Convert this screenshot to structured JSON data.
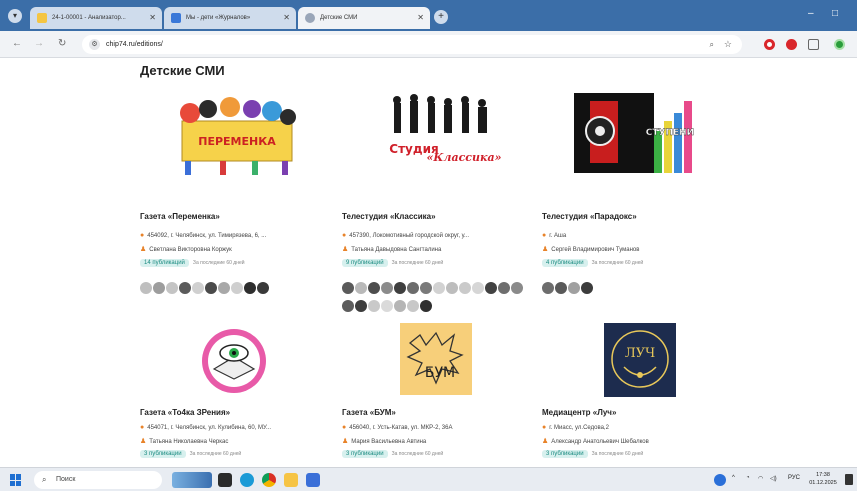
{
  "browser": {
    "tabs": [
      {
        "label": "24-1-00001 - Анализатор...",
        "favicon_color": "#f4c542",
        "active": false
      },
      {
        "label": "Мы - дети «Журналов»",
        "favicon_color": "#3a78d8",
        "active": false
      },
      {
        "label": "Детские СМИ",
        "favicon_color": "#9aa6b8",
        "active": true
      }
    ],
    "new_tab_symbol": "+",
    "url": "chip74.ru/editions/",
    "window_controls": {
      "minimize": "–",
      "maximize": "□"
    }
  },
  "page": {
    "title": "Детские СМИ"
  },
  "cards": [
    {
      "name": "Газета «Переменка»",
      "address": "454092, г. Челябинск, ул. Тимирязева, 6, ...",
      "person": "Светлана Викторовна Коржук",
      "publications": "14 публикаций",
      "note": "За последние 60 дней",
      "logo_text": "ПЕРЕМЕНКА",
      "avatars": [
        "#bfbfbf",
        "#9d9d9d",
        "#c4c4c4",
        "#5b5b5b",
        "#d0d0d0",
        "#4a4a4a",
        "#a8a8a8",
        "#cfcfcf",
        "#2e2e2e",
        "#3a3a3a"
      ]
    },
    {
      "name": "Телестудия «Классика»",
      "address": "457390, Локомотивный городской округ, у...",
      "person": "Татьяна Давыдовна Сангталина",
      "publications": "9 публикаций",
      "note": "За последние 60 дней",
      "logo_text": "Студия «Классика»",
      "avatars": [
        "#5a5a5a",
        "#b9b9b9",
        "#4d4d4d",
        "#8b8b8b",
        "#3f3f3f",
        "#6c6c6c",
        "#7a7a7a",
        "#d2d2d2",
        "#bdbdbd",
        "#cacaca",
        "#d6d6d6",
        "#424242",
        "#6e6e6e",
        "#8a8a8a",
        "#5c5c5c",
        "#3d3d3d",
        "#c9c9c9",
        "#dadada",
        "#b5b5b5",
        "#c8c8c8",
        "#2f2f2f"
      ]
    },
    {
      "name": "Телестудия «Парадокс»",
      "address": "г. Аша",
      "person": "Сергей Владимирович Туманов",
      "publications": "4 публикации",
      "note": "За последние 60 дней",
      "logo_text": "СТУПЕНИ",
      "avatars": [
        "#6d6d6d",
        "#595959",
        "#a0a0a0",
        "#3c3c3c"
      ]
    },
    {
      "name": "Газета «То4ка ЗРения»",
      "address": "454071, г. Челябинск, ул. Кулибина, 60, МУ...",
      "person": "Татьяна Николаевна Черкас",
      "publications": "3 публикации",
      "note": "За последние 60 дней",
      "logo_text": "",
      "avatars": []
    },
    {
      "name": "Газета «БУМ»",
      "address": "456040, г. Усть-Катав, ул. МКР-2, 36А",
      "person": "Мария Васильевна Автина",
      "publications": "3 публикации",
      "note": "За последние 60 дней",
      "logo_text": "БУМ",
      "avatars": []
    },
    {
      "name": "Медиацентр «Луч»",
      "address": "г. Миасс, ул.Седова,2",
      "person": "Александр Анатольевич Шебалков",
      "publications": "3 публикации",
      "note": "За последние 60 дней",
      "logo_text": "ЛУЧ",
      "avatars": []
    }
  ],
  "taskbar": {
    "search_placeholder": "Поиск",
    "lang": "РУС",
    "time": "17:38",
    "date": "01.12.2025"
  },
  "colors": {
    "browser_frame": "#3b6ea8",
    "accent_orange": "#e8832a",
    "badge_bg": "#d7f0ee",
    "badge_text": "#1b8b80"
  }
}
